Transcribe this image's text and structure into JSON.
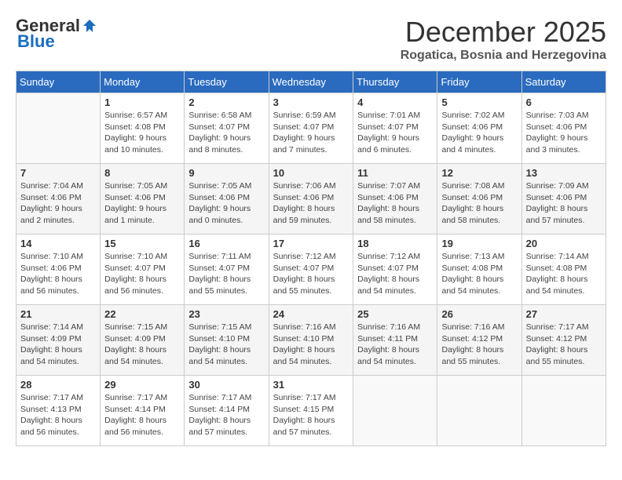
{
  "header": {
    "logo_general": "General",
    "logo_blue": "Blue",
    "month_title": "December 2025",
    "subtitle": "Rogatica, Bosnia and Herzegovina"
  },
  "days_of_week": [
    "Sunday",
    "Monday",
    "Tuesday",
    "Wednesday",
    "Thursday",
    "Friday",
    "Saturday"
  ],
  "weeks": [
    [
      {
        "day": "",
        "info": ""
      },
      {
        "day": "1",
        "info": "Sunrise: 6:57 AM\nSunset: 4:08 PM\nDaylight: 9 hours\nand 10 minutes."
      },
      {
        "day": "2",
        "info": "Sunrise: 6:58 AM\nSunset: 4:07 PM\nDaylight: 9 hours\nand 8 minutes."
      },
      {
        "day": "3",
        "info": "Sunrise: 6:59 AM\nSunset: 4:07 PM\nDaylight: 9 hours\nand 7 minutes."
      },
      {
        "day": "4",
        "info": "Sunrise: 7:01 AM\nSunset: 4:07 PM\nDaylight: 9 hours\nand 6 minutes."
      },
      {
        "day": "5",
        "info": "Sunrise: 7:02 AM\nSunset: 4:06 PM\nDaylight: 9 hours\nand 4 minutes."
      },
      {
        "day": "6",
        "info": "Sunrise: 7:03 AM\nSunset: 4:06 PM\nDaylight: 9 hours\nand 3 minutes."
      }
    ],
    [
      {
        "day": "7",
        "info": "Sunrise: 7:04 AM\nSunset: 4:06 PM\nDaylight: 9 hours\nand 2 minutes."
      },
      {
        "day": "8",
        "info": "Sunrise: 7:05 AM\nSunset: 4:06 PM\nDaylight: 9 hours\nand 1 minute."
      },
      {
        "day": "9",
        "info": "Sunrise: 7:05 AM\nSunset: 4:06 PM\nDaylight: 9 hours\nand 0 minutes."
      },
      {
        "day": "10",
        "info": "Sunrise: 7:06 AM\nSunset: 4:06 PM\nDaylight: 8 hours\nand 59 minutes."
      },
      {
        "day": "11",
        "info": "Sunrise: 7:07 AM\nSunset: 4:06 PM\nDaylight: 8 hours\nand 58 minutes."
      },
      {
        "day": "12",
        "info": "Sunrise: 7:08 AM\nSunset: 4:06 PM\nDaylight: 8 hours\nand 58 minutes."
      },
      {
        "day": "13",
        "info": "Sunrise: 7:09 AM\nSunset: 4:06 PM\nDaylight: 8 hours\nand 57 minutes."
      }
    ],
    [
      {
        "day": "14",
        "info": "Sunrise: 7:10 AM\nSunset: 4:06 PM\nDaylight: 8 hours\nand 56 minutes."
      },
      {
        "day": "15",
        "info": "Sunrise: 7:10 AM\nSunset: 4:07 PM\nDaylight: 8 hours\nand 56 minutes."
      },
      {
        "day": "16",
        "info": "Sunrise: 7:11 AM\nSunset: 4:07 PM\nDaylight: 8 hours\nand 55 minutes."
      },
      {
        "day": "17",
        "info": "Sunrise: 7:12 AM\nSunset: 4:07 PM\nDaylight: 8 hours\nand 55 minutes."
      },
      {
        "day": "18",
        "info": "Sunrise: 7:12 AM\nSunset: 4:07 PM\nDaylight: 8 hours\nand 54 minutes."
      },
      {
        "day": "19",
        "info": "Sunrise: 7:13 AM\nSunset: 4:08 PM\nDaylight: 8 hours\nand 54 minutes."
      },
      {
        "day": "20",
        "info": "Sunrise: 7:14 AM\nSunset: 4:08 PM\nDaylight: 8 hours\nand 54 minutes."
      }
    ],
    [
      {
        "day": "21",
        "info": "Sunrise: 7:14 AM\nSunset: 4:09 PM\nDaylight: 8 hours\nand 54 minutes."
      },
      {
        "day": "22",
        "info": "Sunrise: 7:15 AM\nSunset: 4:09 PM\nDaylight: 8 hours\nand 54 minutes."
      },
      {
        "day": "23",
        "info": "Sunrise: 7:15 AM\nSunset: 4:10 PM\nDaylight: 8 hours\nand 54 minutes."
      },
      {
        "day": "24",
        "info": "Sunrise: 7:16 AM\nSunset: 4:10 PM\nDaylight: 8 hours\nand 54 minutes."
      },
      {
        "day": "25",
        "info": "Sunrise: 7:16 AM\nSunset: 4:11 PM\nDaylight: 8 hours\nand 54 minutes."
      },
      {
        "day": "26",
        "info": "Sunrise: 7:16 AM\nSunset: 4:12 PM\nDaylight: 8 hours\nand 55 minutes."
      },
      {
        "day": "27",
        "info": "Sunrise: 7:17 AM\nSunset: 4:12 PM\nDaylight: 8 hours\nand 55 minutes."
      }
    ],
    [
      {
        "day": "28",
        "info": "Sunrise: 7:17 AM\nSunset: 4:13 PM\nDaylight: 8 hours\nand 56 minutes."
      },
      {
        "day": "29",
        "info": "Sunrise: 7:17 AM\nSunset: 4:14 PM\nDaylight: 8 hours\nand 56 minutes."
      },
      {
        "day": "30",
        "info": "Sunrise: 7:17 AM\nSunset: 4:14 PM\nDaylight: 8 hours\nand 57 minutes."
      },
      {
        "day": "31",
        "info": "Sunrise: 7:17 AM\nSunset: 4:15 PM\nDaylight: 8 hours\nand 57 minutes."
      },
      {
        "day": "",
        "info": ""
      },
      {
        "day": "",
        "info": ""
      },
      {
        "day": "",
        "info": ""
      }
    ]
  ]
}
